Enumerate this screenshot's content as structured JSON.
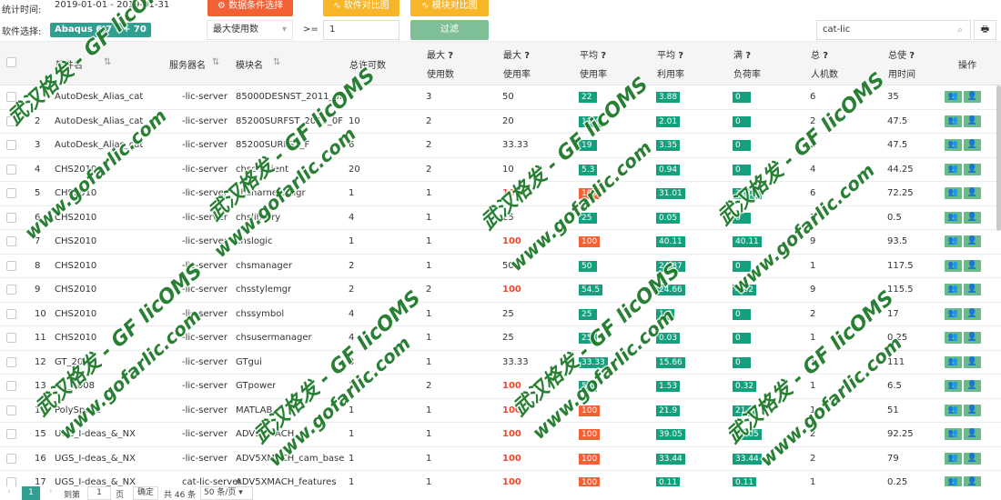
{
  "filters": {
    "period_label": "统计时间:",
    "period_value": "2019-01-01 - 2019-01-31",
    "software_label": "软件选择:",
    "selected_software": "Abaqus 6.7",
    "more_count": "+ 70",
    "metric_select": "最大使用数",
    "operator": ">=",
    "threshold_value": "1",
    "filter_button": "过滤",
    "search_value": "cat-lic",
    "btn_data_condition": "数据条件选择",
    "btn_software_compare": "软件对比图",
    "btn_module_compare": "模块对比图"
  },
  "columns": {
    "software": "软件名",
    "server": "服务器名",
    "module": "模块名",
    "total_licenses": "总许可数",
    "max_label_1": "最大",
    "max_used": "使用数",
    "max_label_2": "最大",
    "max_rate": "使用率",
    "avg_label_1": "平均",
    "avg_rate": "使用率",
    "avg_label_2": "平均",
    "avg_util": "利用率",
    "full_label": "满",
    "full_load": "负荷率",
    "total_label": "总",
    "total_users": "人机数",
    "total_time_label": "总使",
    "total_time": "用时间",
    "actions": "操作",
    "q": "?"
  },
  "rows": [
    {
      "n": "1",
      "software": "AutoDesk_Alias_cat",
      "server": "-lic-server",
      "module": "85000DESNST_2011_0F",
      "total": "6",
      "max": "3",
      "maxrate": "50",
      "maxhi": false,
      "avg": "22",
      "avghi": false,
      "util": "3.88",
      "full": "0",
      "users": "6",
      "time": "35"
    },
    {
      "n": "2",
      "software": "AutoDesk_Alias_cat",
      "server": "-lic-server",
      "module": "85200SURFST_2011_0F",
      "total": "10",
      "max": "2",
      "maxrate": "20",
      "maxhi": false,
      "avg": "11.4",
      "avghi": false,
      "util": "2.01",
      "full": "0",
      "users": "2",
      "time": "47.5"
    },
    {
      "n": "3",
      "software": "AutoDesk_Alias_cat",
      "server": "-lic-server",
      "module": "85200SURFST_F",
      "total": "6",
      "max": "2",
      "maxrate": "33.33",
      "maxhi": false,
      "avg": "19",
      "avghi": false,
      "util": "3.35",
      "full": "0",
      "users": "2",
      "time": "47.5"
    },
    {
      "n": "4",
      "software": "CHS2010",
      "server": "-lic-server",
      "module": "chscisclient",
      "total": "20",
      "max": "2",
      "maxrate": "10",
      "maxhi": false,
      "avg": "5.3",
      "avghi": false,
      "util": "0.94",
      "full": "0",
      "users": "4",
      "time": "44.25"
    },
    {
      "n": "5",
      "software": "CHS2010",
      "server": "-lic-server",
      "module": "chsharnessmgr",
      "total": "1",
      "max": "1",
      "maxrate": "100",
      "maxhi": true,
      "avg": "100",
      "avghi": true,
      "util": "31.01",
      "full": "31.01",
      "users": "6",
      "time": "72.25"
    },
    {
      "n": "6",
      "software": "CHS2010",
      "server": "-lic-server",
      "module": "chslibrary",
      "total": "4",
      "max": "1",
      "maxrate": "25",
      "maxhi": false,
      "avg": "25",
      "avghi": false,
      "util": "0.05",
      "full": "0",
      "users": "1",
      "time": "0.5"
    },
    {
      "n": "7",
      "software": "CHS2010",
      "server": "-lic-server",
      "module": "chslogic",
      "total": "1",
      "max": "1",
      "maxrate": "100",
      "maxhi": true,
      "avg": "100",
      "avghi": true,
      "util": "40.11",
      "full": "40.11",
      "users": "9",
      "time": "93.5"
    },
    {
      "n": "8",
      "software": "CHS2010",
      "server": "-lic-server",
      "module": "chsmanager",
      "total": "2",
      "max": "1",
      "maxrate": "50",
      "maxhi": false,
      "avg": "50",
      "avghi": false,
      "util": "24.87",
      "full": "0",
      "users": "1",
      "time": "117.5"
    },
    {
      "n": "9",
      "software": "CHS2010",
      "server": "-lic-server",
      "module": "chsstylemgr",
      "total": "2",
      "max": "2",
      "maxrate": "100",
      "maxhi": true,
      "avg": "54.5",
      "avghi": false,
      "util": "24.66",
      "full": "4.02",
      "users": "9",
      "time": "115.5"
    },
    {
      "n": "10",
      "software": "CHS2010",
      "server": "-lic-server",
      "module": "chssymbol",
      "total": "4",
      "max": "1",
      "maxrate": "25",
      "maxhi": false,
      "avg": "25",
      "avghi": false,
      "util": "1.8",
      "full": "0",
      "users": "2",
      "time": "17"
    },
    {
      "n": "11",
      "software": "CHS2010",
      "server": "-lic-server",
      "module": "chsusermanager",
      "total": "4",
      "max": "1",
      "maxrate": "25",
      "maxhi": false,
      "avg": "25",
      "avghi": false,
      "util": "0.03",
      "full": "0",
      "users": "1",
      "time": "0.25"
    },
    {
      "n": "12",
      "software": "GT_2008",
      "server": "-lic-server",
      "module": "GTgui",
      "total": "3",
      "max": "1",
      "maxrate": "33.33",
      "maxhi": false,
      "avg": "33.33",
      "avghi": false,
      "util": "15.66",
      "full": "0",
      "users": "1",
      "time": "111"
    },
    {
      "n": "13",
      "software": "GT_2008",
      "server": "-lic-server",
      "module": "GTpower",
      "total": "2",
      "max": "2",
      "maxrate": "100",
      "maxhi": true,
      "avg": "56",
      "avghi": false,
      "util": "1.53",
      "full": "0.32",
      "users": "1",
      "time": "6.5"
    },
    {
      "n": "14",
      "software": "PolySpace",
      "server": "-lic-server",
      "module": "MATLAB",
      "total": "1",
      "max": "1",
      "maxrate": "100",
      "maxhi": true,
      "avg": "100",
      "avghi": true,
      "util": "21.9",
      "full": "21.9",
      "users": "1",
      "time": "51"
    },
    {
      "n": "15",
      "software": "UGS_I-deas_&_NX",
      "server": "-lic-server",
      "module": "ADV5XMACH",
      "total": "1",
      "max": "1",
      "maxrate": "100",
      "maxhi": true,
      "avg": "100",
      "avghi": true,
      "util": "39.05",
      "full": "39.05",
      "users": "2",
      "time": "92.25"
    },
    {
      "n": "16",
      "software": "UGS_I-deas_&_NX",
      "server": "-lic-server",
      "module": "ADV5XMACH_cam_base",
      "total": "1",
      "max": "1",
      "maxrate": "100",
      "maxhi": true,
      "avg": "100",
      "avghi": true,
      "util": "33.44",
      "full": "33.44",
      "users": "2",
      "time": "79"
    },
    {
      "n": "17",
      "software": "UGS_I-deas_&_NX",
      "server": "cat-lic-server",
      "module": "ADV5XMACH_features",
      "total": "1",
      "max": "1",
      "maxrate": "100",
      "maxhi": true,
      "avg": "100",
      "avghi": true,
      "util": "0.11",
      "full": "0.11",
      "users": "1",
      "time": "0.25"
    }
  ],
  "pagination": {
    "current": "1",
    "goto_label": "到第",
    "goto_value": "1",
    "page_unit": "页",
    "confirm": "确定",
    "total": "共 46 条",
    "per_page": "50 条/页"
  },
  "watermarks": {
    "brand": "武汉格发 - GF licOMS",
    "url": "www.gofarlic.com"
  },
  "colors": {
    "accent": "#2e9f90",
    "green": "#15a07d",
    "orange": "#f26035",
    "yellow": "#f7b52a",
    "red": "#f0452a"
  }
}
